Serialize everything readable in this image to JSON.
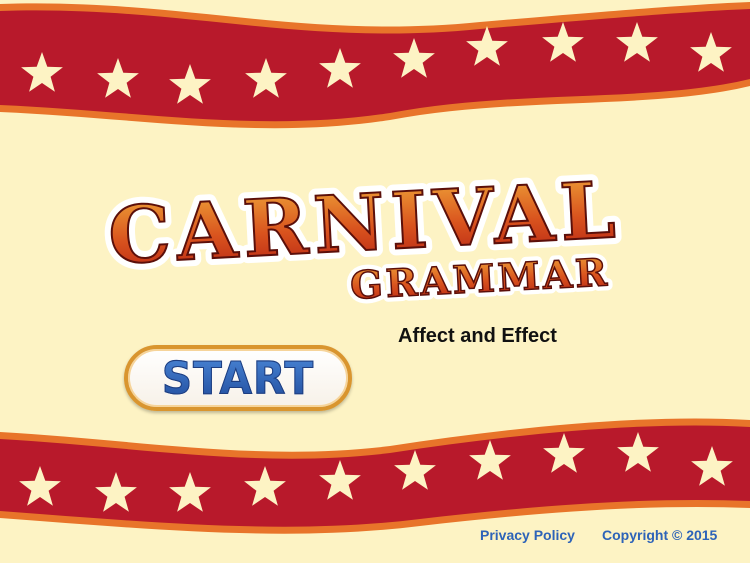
{
  "game": {
    "title_main": "CARNIVAL",
    "title_sub": "GRAMMAR",
    "subtitle": "Affect and Effect"
  },
  "buttons": {
    "start_label": "START"
  },
  "footer": {
    "privacy_label": "Privacy Policy",
    "copyright_label": "Copyright © 2015"
  },
  "colors": {
    "background": "#fdf3c4",
    "banner_red": "#b8192b",
    "banner_edge": "#e8742a",
    "star": "#fdf3c4",
    "title_top": "#f0a83a",
    "title_bottom": "#b52314",
    "start_blue": "#2f68c3",
    "link_blue": "#2d63b8"
  },
  "icons": [
    "star-icon"
  ]
}
